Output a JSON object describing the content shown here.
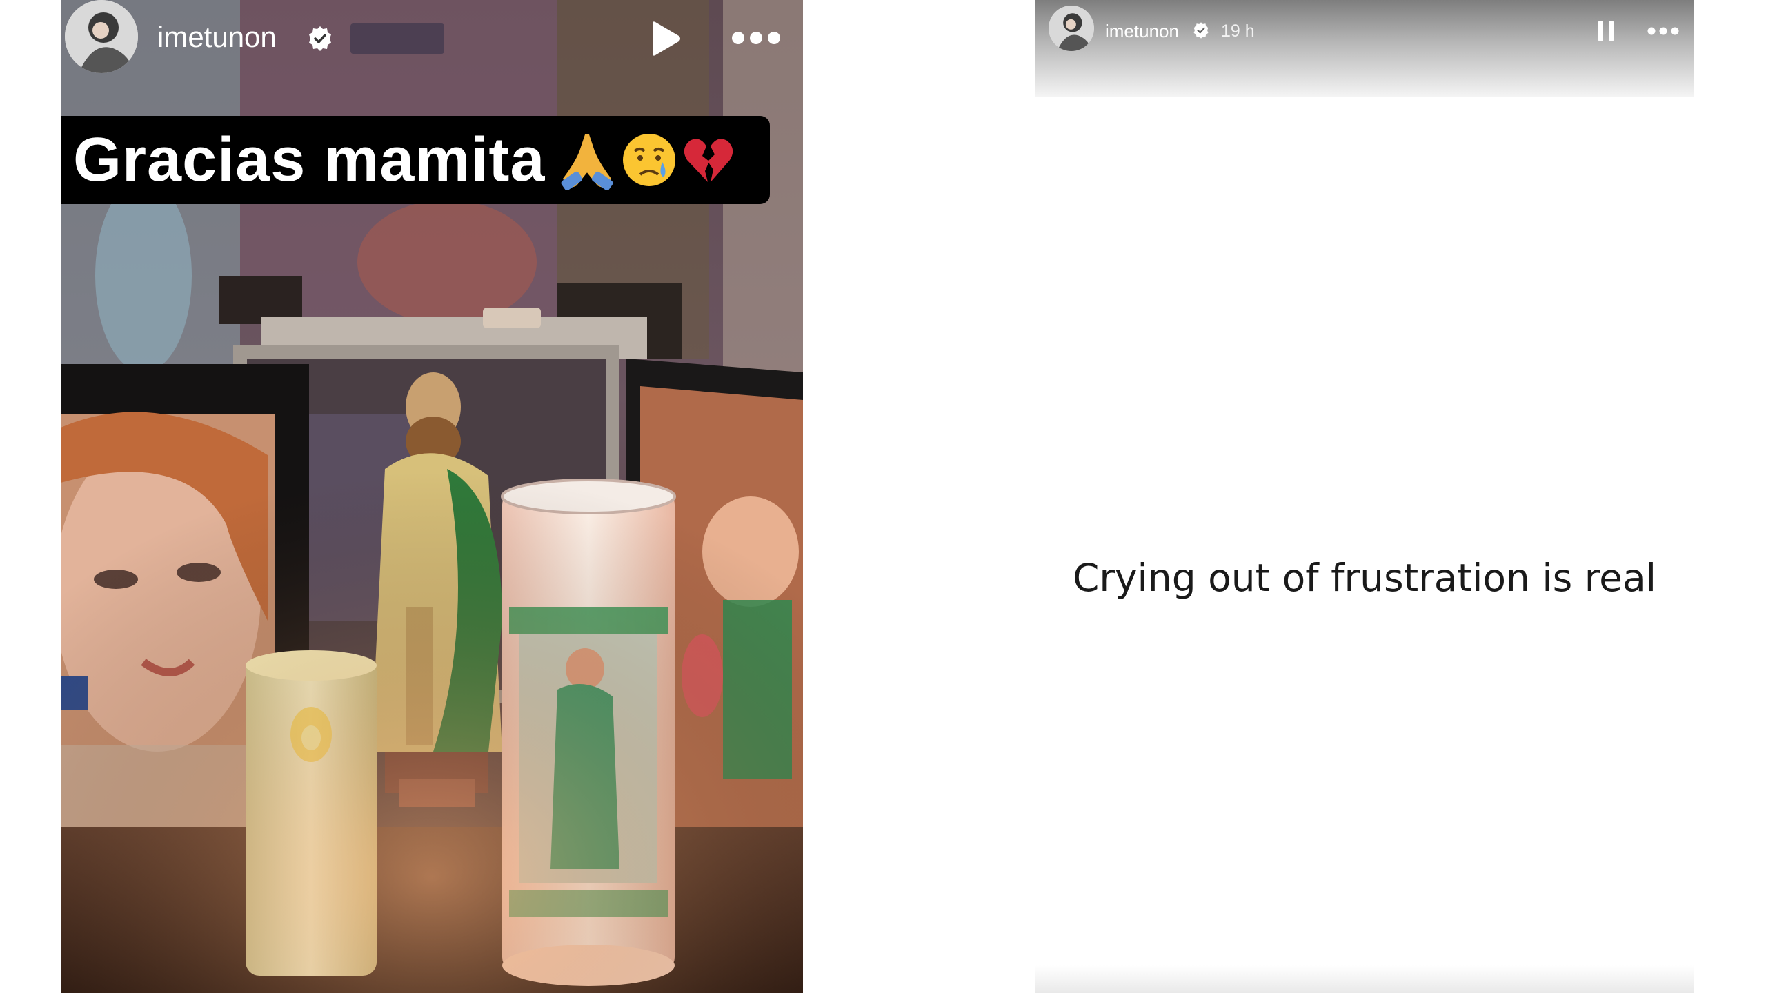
{
  "left_story": {
    "username": "imetunon",
    "caption": "Gracias mamita",
    "caption_emojis": [
      "folded-hands",
      "crying-face",
      "broken-heart"
    ],
    "icons": {
      "verified": "verified-badge-icon",
      "play": "play-icon",
      "more": "more-horizontal-icon"
    }
  },
  "right_story": {
    "username": "imetunon",
    "timestamp": "19 h",
    "text": "Crying out of frustration is real",
    "icons": {
      "verified": "verified-badge-icon",
      "pause": "pause-icon",
      "more": "more-horizontal-icon"
    }
  },
  "colors": {
    "caption_background": "#000000",
    "caption_text": "#ffffff",
    "story_text": "#1a1a1a",
    "header_gradient_top": "#7e7e7e"
  }
}
